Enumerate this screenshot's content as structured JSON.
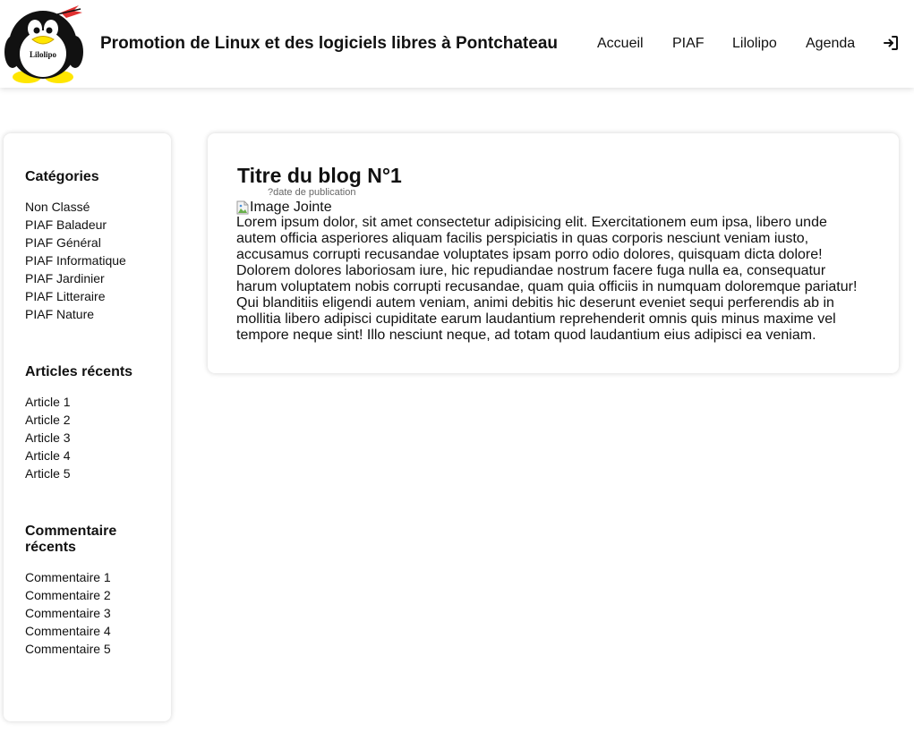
{
  "header": {
    "logo_text": "Lilolipo",
    "site_title": "Promotion de Linux et des logiciels libres à Pontchateau",
    "nav": {
      "accueil": "Accueil",
      "piaf": "PIAF",
      "lilolipo": "Lilolipo",
      "agenda": "Agenda"
    },
    "login_icon": "sign-in-icon"
  },
  "sidebar": {
    "categories_title": "Catégories",
    "categories": [
      "Non Classé",
      "PIAF Baladeur",
      "PIAF Général",
      "PIAF Informatique",
      "PIAF Jardinier",
      "PIAF Litteraire",
      "PIAF Nature"
    ],
    "articles_title": "Articles récents",
    "articles": [
      "Article 1",
      "Article 2",
      "Article 3",
      "Article 4",
      "Article 5"
    ],
    "comments_title": "Commentaire récents",
    "comments": [
      "Commentaire 1",
      "Commentaire 2",
      "Commentaire 3",
      "Commentaire 4",
      "Commentaire 5"
    ]
  },
  "post": {
    "title": "Titre du blog N°1",
    "date": "?date de publication",
    "image_alt": "Image Jointe",
    "body": "Lorem ipsum dolor, sit amet consectetur adipisicing elit. Exercitationem eum ipsa, libero unde autem officia asperiores aliquam facilis perspiciatis in quas corporis nesciunt veniam iusto, accusamus corrupti recusandae voluptates ipsam porro odio dolores, quisquam dicta dolore! Dolorem dolores laboriosam iure, hic repudiandae nostrum facere fuga nulla ea, consequatur harum voluptatem nobis corrupti recusandae, quam quia officiis in numquam doloremque pariatur! Qui blanditiis eligendi autem veniam, animi debitis hic deserunt eveniet sequi perferendis ab in mollitia libero adipisci cupiditate earum laudantium reprehenderit omnis quis minus maxime vel tempore neque sint! Illo nesciunt neque, ad totam quod laudantium eius adipisci ea veniam."
  },
  "colors": {
    "text": "#111111",
    "date": "#666666",
    "background": "#ffffff",
    "logo_feather": "#e03030",
    "logo_feet": "#ffe600"
  }
}
